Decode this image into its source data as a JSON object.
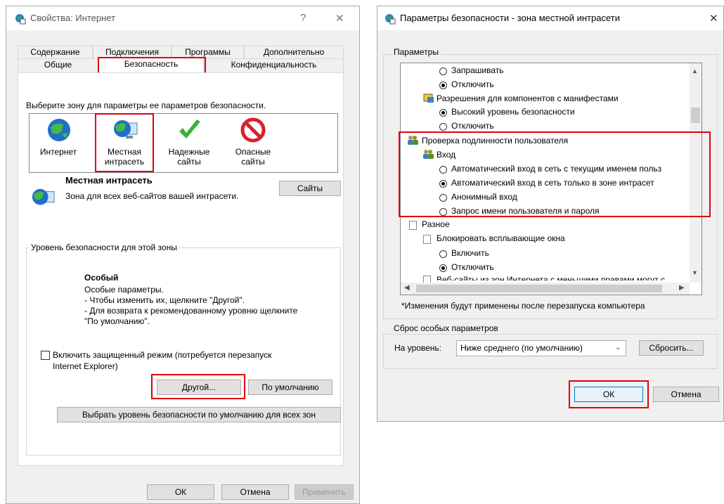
{
  "left": {
    "title": "Свойства: Интернет",
    "help": "?",
    "close": "✕",
    "tabs_row1": [
      "Содержание",
      "Подключения",
      "Программы",
      "Дополнительно"
    ],
    "tabs_row2": [
      "Общие",
      "Безопасность",
      "Конфиденциальность"
    ],
    "zone_prompt": "Выберите зону для параметры ее параметров безопасности.",
    "zones": [
      {
        "l1": "Интернет",
        "l2": ""
      },
      {
        "l1": "Местная",
        "l2": "интрасеть"
      },
      {
        "l1": "Надежные",
        "l2": "сайты"
      },
      {
        "l1": "Опасные",
        "l2": "сайты"
      }
    ],
    "zone_title": "Местная интрасеть",
    "zone_desc": "Зона для всех веб-сайтов вашей интрасети.",
    "sites_button": "Сайты",
    "level_group": "Уровень безопасности для этой зоны",
    "level_name": "Особый",
    "level_lines": [
      "Особые параметры.",
      "- Чтобы изменить их, щелкните \"Другой\".",
      "- Для возврата к рекомендованному уровню щелкните",
      "\"По умолчанию\"."
    ],
    "protected_mode_1": "Включить защищенный режим (потребуется перезапуск",
    "protected_mode_2": "Internet Explorer)",
    "custom_button": "Другой...",
    "default_button": "По умолчанию",
    "all_zones_button": "Выбрать уровень безопасности по умолчанию для всех зон",
    "ok": "ОК",
    "cancel": "Отмена",
    "apply": "Применить"
  },
  "right": {
    "title": "Параметры безопасности - зона местной интрасети",
    "close": "✕",
    "params_group": "Параметры",
    "tree": [
      "Запрашивать",
      "Отключить",
      "Разрешения для компонентов с манифестами",
      "Высокий уровень безопасности",
      "Отключить",
      "Проверка подлинности пользователя",
      "Вход",
      "Автоматический вход в сеть с текущим именем польз",
      "Автоматический вход в сеть только в зоне интрасет",
      "Анонимный вход",
      "Запрос имени пользователя и пароля",
      "Разное",
      "Блокировать всплывающие окна",
      "Включить",
      "Отключить",
      "Веб-сайты из зон Интернета с меньшими правами могут с"
    ],
    "note": "*Изменения будут применены после перезапуска компьютера",
    "reset_group": "Сброс особых параметров",
    "reset_label": "На уровень:",
    "reset_select": "Ниже среднего (по умолчанию)",
    "reset_button": "Сбросить...",
    "ok": "ОК",
    "cancel": "Отмена"
  },
  "colors": {
    "accent": "#0078d7",
    "highlight": "#e0000f"
  }
}
